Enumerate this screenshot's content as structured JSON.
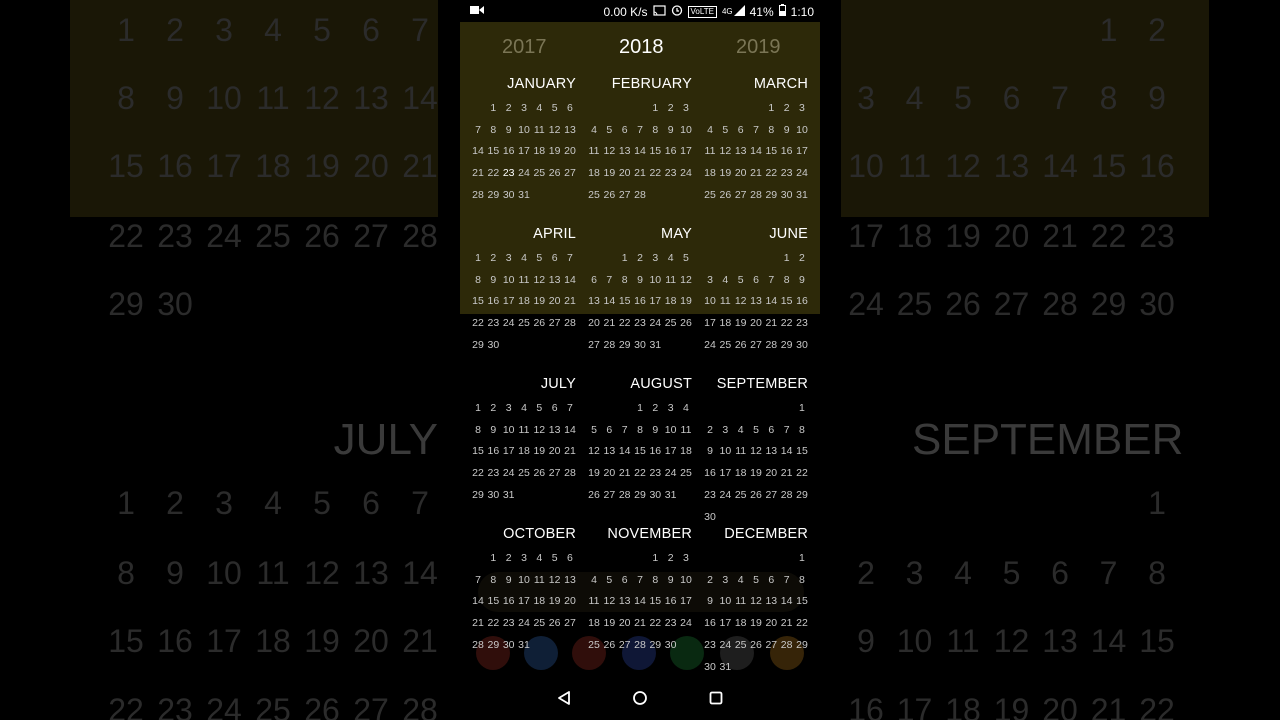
{
  "status_bar": {
    "network_speed": "0.00 K/s",
    "network_type": "4G",
    "volte": "VoLTE",
    "battery_percent": "41%",
    "time": "1:10"
  },
  "years": {
    "prev": "2017",
    "current": "2018",
    "next": "2019"
  },
  "today_date": 23,
  "today_month": "JANUARY",
  "months": [
    {
      "name": "JANUARY",
      "offset": 1,
      "days": 31
    },
    {
      "name": "FEBRUARY",
      "offset": 4,
      "days": 28
    },
    {
      "name": "MARCH",
      "offset": 4,
      "days": 31
    },
    {
      "name": "APRIL",
      "offset": 0,
      "days": 30
    },
    {
      "name": "MAY",
      "offset": 2,
      "days": 31
    },
    {
      "name": "JUNE",
      "offset": 5,
      "days": 30
    },
    {
      "name": "JULY",
      "offset": 0,
      "days": 31
    },
    {
      "name": "AUGUST",
      "offset": 3,
      "days": 31
    },
    {
      "name": "SEPTEMBER",
      "offset": 6,
      "days": 30
    },
    {
      "name": "OCTOBER",
      "offset": 1,
      "days": 31
    },
    {
      "name": "NOVEMBER",
      "offset": 4,
      "days": 30
    },
    {
      "name": "DECEMBER",
      "offset": 6,
      "days": 31
    }
  ],
  "background": {
    "left_month_label": "JULY",
    "right_month_label": "SEPTEMBER"
  },
  "colors": {
    "today_marker": "#e11d1d",
    "panel_yellow": "#2d2909",
    "muted_year": "#7a7555"
  }
}
